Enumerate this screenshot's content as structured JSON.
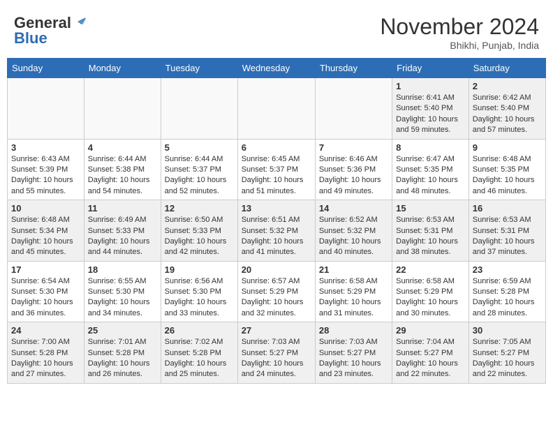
{
  "header": {
    "logo_general": "General",
    "logo_blue": "Blue",
    "title": "November 2024",
    "location": "Bhikhi, Punjab, India"
  },
  "days_of_week": [
    "Sunday",
    "Monday",
    "Tuesday",
    "Wednesday",
    "Thursday",
    "Friday",
    "Saturday"
  ],
  "weeks": [
    [
      {
        "day": "",
        "info": ""
      },
      {
        "day": "",
        "info": ""
      },
      {
        "day": "",
        "info": ""
      },
      {
        "day": "",
        "info": ""
      },
      {
        "day": "",
        "info": ""
      },
      {
        "day": "1",
        "info": "Sunrise: 6:41 AM\nSunset: 5:40 PM\nDaylight: 10 hours and 59 minutes."
      },
      {
        "day": "2",
        "info": "Sunrise: 6:42 AM\nSunset: 5:40 PM\nDaylight: 10 hours and 57 minutes."
      }
    ],
    [
      {
        "day": "3",
        "info": "Sunrise: 6:43 AM\nSunset: 5:39 PM\nDaylight: 10 hours and 55 minutes."
      },
      {
        "day": "4",
        "info": "Sunrise: 6:44 AM\nSunset: 5:38 PM\nDaylight: 10 hours and 54 minutes."
      },
      {
        "day": "5",
        "info": "Sunrise: 6:44 AM\nSunset: 5:37 PM\nDaylight: 10 hours and 52 minutes."
      },
      {
        "day": "6",
        "info": "Sunrise: 6:45 AM\nSunset: 5:37 PM\nDaylight: 10 hours and 51 minutes."
      },
      {
        "day": "7",
        "info": "Sunrise: 6:46 AM\nSunset: 5:36 PM\nDaylight: 10 hours and 49 minutes."
      },
      {
        "day": "8",
        "info": "Sunrise: 6:47 AM\nSunset: 5:35 PM\nDaylight: 10 hours and 48 minutes."
      },
      {
        "day": "9",
        "info": "Sunrise: 6:48 AM\nSunset: 5:35 PM\nDaylight: 10 hours and 46 minutes."
      }
    ],
    [
      {
        "day": "10",
        "info": "Sunrise: 6:48 AM\nSunset: 5:34 PM\nDaylight: 10 hours and 45 minutes."
      },
      {
        "day": "11",
        "info": "Sunrise: 6:49 AM\nSunset: 5:33 PM\nDaylight: 10 hours and 44 minutes."
      },
      {
        "day": "12",
        "info": "Sunrise: 6:50 AM\nSunset: 5:33 PM\nDaylight: 10 hours and 42 minutes."
      },
      {
        "day": "13",
        "info": "Sunrise: 6:51 AM\nSunset: 5:32 PM\nDaylight: 10 hours and 41 minutes."
      },
      {
        "day": "14",
        "info": "Sunrise: 6:52 AM\nSunset: 5:32 PM\nDaylight: 10 hours and 40 minutes."
      },
      {
        "day": "15",
        "info": "Sunrise: 6:53 AM\nSunset: 5:31 PM\nDaylight: 10 hours and 38 minutes."
      },
      {
        "day": "16",
        "info": "Sunrise: 6:53 AM\nSunset: 5:31 PM\nDaylight: 10 hours and 37 minutes."
      }
    ],
    [
      {
        "day": "17",
        "info": "Sunrise: 6:54 AM\nSunset: 5:30 PM\nDaylight: 10 hours and 36 minutes."
      },
      {
        "day": "18",
        "info": "Sunrise: 6:55 AM\nSunset: 5:30 PM\nDaylight: 10 hours and 34 minutes."
      },
      {
        "day": "19",
        "info": "Sunrise: 6:56 AM\nSunset: 5:30 PM\nDaylight: 10 hours and 33 minutes."
      },
      {
        "day": "20",
        "info": "Sunrise: 6:57 AM\nSunset: 5:29 PM\nDaylight: 10 hours and 32 minutes."
      },
      {
        "day": "21",
        "info": "Sunrise: 6:58 AM\nSunset: 5:29 PM\nDaylight: 10 hours and 31 minutes."
      },
      {
        "day": "22",
        "info": "Sunrise: 6:58 AM\nSunset: 5:29 PM\nDaylight: 10 hours and 30 minutes."
      },
      {
        "day": "23",
        "info": "Sunrise: 6:59 AM\nSunset: 5:28 PM\nDaylight: 10 hours and 28 minutes."
      }
    ],
    [
      {
        "day": "24",
        "info": "Sunrise: 7:00 AM\nSunset: 5:28 PM\nDaylight: 10 hours and 27 minutes."
      },
      {
        "day": "25",
        "info": "Sunrise: 7:01 AM\nSunset: 5:28 PM\nDaylight: 10 hours and 26 minutes."
      },
      {
        "day": "26",
        "info": "Sunrise: 7:02 AM\nSunset: 5:28 PM\nDaylight: 10 hours and 25 minutes."
      },
      {
        "day": "27",
        "info": "Sunrise: 7:03 AM\nSunset: 5:27 PM\nDaylight: 10 hours and 24 minutes."
      },
      {
        "day": "28",
        "info": "Sunrise: 7:03 AM\nSunset: 5:27 PM\nDaylight: 10 hours and 23 minutes."
      },
      {
        "day": "29",
        "info": "Sunrise: 7:04 AM\nSunset: 5:27 PM\nDaylight: 10 hours and 22 minutes."
      },
      {
        "day": "30",
        "info": "Sunrise: 7:05 AM\nSunset: 5:27 PM\nDaylight: 10 hours and 22 minutes."
      }
    ]
  ]
}
